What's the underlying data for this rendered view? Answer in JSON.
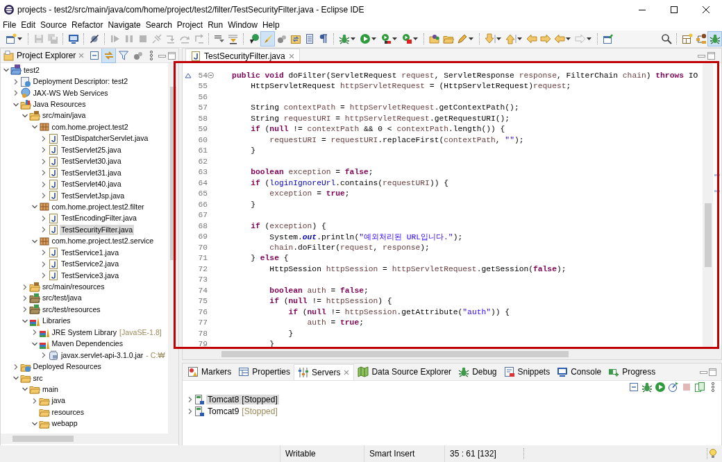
{
  "window": {
    "title": "projects - test2/src/main/java/com/home/project/test2/filter/TestSecurityFilter.java - Eclipse IDE"
  },
  "menu": [
    "File",
    "Edit",
    "Source",
    "Refactor",
    "Navigate",
    "Search",
    "Project",
    "Run",
    "Window",
    "Help"
  ],
  "project_explorer": {
    "title": "Project Explorer",
    "tree": [
      {
        "label": "test2",
        "kind": "project",
        "expanded": true,
        "selected": false,
        "children": [
          {
            "label": "Deployment Descriptor: test2",
            "kind": "descriptor",
            "expanded": false,
            "selected": false
          },
          {
            "label": "JAX-WS Web Services",
            "kind": "webservices",
            "expanded": false,
            "selected": false
          },
          {
            "label": "Java Resources",
            "kind": "javaresources",
            "expanded": true,
            "selected": false,
            "children": [
              {
                "label": "src/main/java",
                "kind": "sourcefolder",
                "expanded": true,
                "selected": false,
                "children": [
                  {
                    "label": "com.home.project.test2",
                    "kind": "package",
                    "expanded": true,
                    "selected": false,
                    "children": [
                      {
                        "label": "TestDispatcherServlet.java",
                        "kind": "javafile",
                        "expanded": false,
                        "selected": false
                      },
                      {
                        "label": "TestServlet25.java",
                        "kind": "javafile",
                        "expanded": false,
                        "selected": false
                      },
                      {
                        "label": "TestServlet30.java",
                        "kind": "javafile",
                        "expanded": false,
                        "selected": false
                      },
                      {
                        "label": "TestServlet31.java",
                        "kind": "javafile",
                        "expanded": false,
                        "selected": false
                      },
                      {
                        "label": "TestServlet40.java",
                        "kind": "javafile",
                        "expanded": false,
                        "selected": false
                      },
                      {
                        "label": "TestServletJsp.java",
                        "kind": "javafile",
                        "expanded": false,
                        "selected": false
                      }
                    ]
                  },
                  {
                    "label": "com.home.project.test2.filter",
                    "kind": "package",
                    "expanded": true,
                    "selected": false,
                    "children": [
                      {
                        "label": "TestEncodingFilter.java",
                        "kind": "javafile",
                        "expanded": false,
                        "selected": false
                      },
                      {
                        "label": "TestSecurityFilter.java",
                        "kind": "javafile",
                        "expanded": false,
                        "selected": true
                      }
                    ]
                  },
                  {
                    "label": "com.home.project.test2.service",
                    "kind": "package",
                    "expanded": true,
                    "selected": false,
                    "children": [
                      {
                        "label": "TestService1.java",
                        "kind": "javafile",
                        "expanded": false,
                        "selected": false
                      },
                      {
                        "label": "TestService2.java",
                        "kind": "javafile",
                        "expanded": false,
                        "selected": false
                      },
                      {
                        "label": "TestService3.java",
                        "kind": "javafile",
                        "expanded": false,
                        "selected": false
                      }
                    ]
                  }
                ]
              },
              {
                "label": "src/main/resources",
                "kind": "sourcefolder",
                "expanded": false,
                "selected": false
              },
              {
                "label": "src/test/java",
                "kind": "testfolder",
                "expanded": false,
                "selected": false
              },
              {
                "label": "src/test/resources",
                "kind": "testfolder",
                "expanded": false,
                "selected": false
              },
              {
                "label": "Libraries",
                "kind": "library",
                "expanded": true,
                "selected": false,
                "children": [
                  {
                    "label": "JRE System Library",
                    "decoration": "[JavaSE-1.8]",
                    "kind": "library",
                    "expanded": false,
                    "selected": false
                  },
                  {
                    "label": "Maven Dependencies",
                    "kind": "library",
                    "expanded": true,
                    "selected": false,
                    "children": [
                      {
                        "label": "javax.servlet-api-3.1.0.jar",
                        "decoration": "- C:₩",
                        "kind": "jar",
                        "expanded": false,
                        "selected": false
                      }
                    ]
                  }
                ]
              }
            ]
          },
          {
            "label": "Deployed Resources",
            "kind": "deployed",
            "expanded": false,
            "selected": false
          },
          {
            "label": "src",
            "kind": "folder",
            "expanded": true,
            "selected": false,
            "children": [
              {
                "label": "main",
                "kind": "folder",
                "expanded": true,
                "selected": false,
                "children": [
                  {
                    "label": "java",
                    "kind": "folder",
                    "expanded": false,
                    "selected": false
                  },
                  {
                    "label": "resources",
                    "kind": "folder",
                    "selected": false
                  },
                  {
                    "label": "webapp",
                    "kind": "folder",
                    "expanded": true,
                    "selected": false
                  }
                ]
              }
            ]
          }
        ]
      }
    ]
  },
  "editor": {
    "tab": {
      "label": "TestSecurityFilter.java",
      "selected": true
    },
    "highlighted": true,
    "lines": [
      {
        "number": "54",
        "override": true,
        "fold_expanded": true,
        "tokens": [
          {
            "kind": "keyword",
            "text": "    public void"
          },
          {
            "kind": "plain",
            "text": " doFilter(ServletRequest "
          },
          {
            "kind": "local",
            "text": "request"
          },
          {
            "kind": "plain",
            "text": ", ServletResponse "
          },
          {
            "kind": "local",
            "text": "response"
          },
          {
            "kind": "plain",
            "text": ", FilterChain "
          },
          {
            "kind": "local",
            "text": "chain"
          },
          {
            "kind": "plain",
            "text": ") "
          },
          {
            "kind": "keyword",
            "text": "throws"
          },
          {
            "kind": "plain",
            "text": " IO"
          }
        ]
      },
      {
        "number": "55",
        "tokens": [
          {
            "kind": "plain",
            "text": "        HttpServletRequest "
          },
          {
            "kind": "local",
            "text": "httpServletRequest"
          },
          {
            "kind": "plain",
            "text": " = (HttpServletRequest)"
          },
          {
            "kind": "local",
            "text": "request"
          },
          {
            "kind": "plain",
            "text": ";"
          }
        ]
      },
      {
        "number": "56"
      },
      {
        "number": "57",
        "tokens": [
          {
            "kind": "plain",
            "text": "        String "
          },
          {
            "kind": "local",
            "text": "contextPath"
          },
          {
            "kind": "plain",
            "text": " = "
          },
          {
            "kind": "local",
            "text": "httpServletRequest"
          },
          {
            "kind": "plain",
            "text": ".getContextPath();"
          }
        ]
      },
      {
        "number": "58",
        "tokens": [
          {
            "kind": "plain",
            "text": "        String "
          },
          {
            "kind": "local",
            "text": "requestURI"
          },
          {
            "kind": "plain",
            "text": " = "
          },
          {
            "kind": "local",
            "text": "httpServletRequest"
          },
          {
            "kind": "plain",
            "text": ".getRequestURI();"
          }
        ]
      },
      {
        "number": "59",
        "tokens": [
          {
            "kind": "keyword",
            "text": "        if"
          },
          {
            "kind": "plain",
            "text": " ("
          },
          {
            "kind": "keyword",
            "text": "null"
          },
          {
            "kind": "plain",
            "text": " != "
          },
          {
            "kind": "local",
            "text": "contextPath"
          },
          {
            "kind": "plain",
            "text": " && 0 < "
          },
          {
            "kind": "local",
            "text": "contextPath"
          },
          {
            "kind": "plain",
            "text": ".length()) {"
          }
        ]
      },
      {
        "number": "60",
        "tokens": [
          {
            "kind": "local",
            "text": "            requestURI"
          },
          {
            "kind": "plain",
            "text": " = "
          },
          {
            "kind": "local",
            "text": "requestURI"
          },
          {
            "kind": "plain",
            "text": ".replaceFirst("
          },
          {
            "kind": "local",
            "text": "contextPath"
          },
          {
            "kind": "plain",
            "text": ", "
          },
          {
            "kind": "string",
            "text": "\"\""
          },
          {
            "kind": "plain",
            "text": ");"
          }
        ]
      },
      {
        "number": "61",
        "tokens": [
          {
            "kind": "plain",
            "text": "        }"
          }
        ]
      },
      {
        "number": "62"
      },
      {
        "number": "63",
        "tokens": [
          {
            "kind": "keyword",
            "text": "        boolean "
          },
          {
            "kind": "local",
            "text": "exception"
          },
          {
            "kind": "plain",
            "text": " = "
          },
          {
            "kind": "keyword",
            "text": "false"
          },
          {
            "kind": "plain",
            "text": ";"
          }
        ]
      },
      {
        "number": "64",
        "tokens": [
          {
            "kind": "keyword",
            "text": "        if"
          },
          {
            "kind": "plain",
            "text": " ("
          },
          {
            "kind": "field",
            "text": "loginIgnoreUrl"
          },
          {
            "kind": "plain",
            "text": ".contains("
          },
          {
            "kind": "local",
            "text": "requestURI"
          },
          {
            "kind": "plain",
            "text": ")) {"
          }
        ]
      },
      {
        "number": "65",
        "tokens": [
          {
            "kind": "local",
            "text": "            exception"
          },
          {
            "kind": "plain",
            "text": " = "
          },
          {
            "kind": "keyword",
            "text": "true"
          },
          {
            "kind": "plain",
            "text": ";"
          }
        ]
      },
      {
        "number": "66",
        "tokens": [
          {
            "kind": "plain",
            "text": "        }"
          }
        ]
      },
      {
        "number": "67"
      },
      {
        "number": "68",
        "tokens": [
          {
            "kind": "keyword",
            "text": "        if"
          },
          {
            "kind": "plain",
            "text": " ("
          },
          {
            "kind": "local",
            "text": "exception"
          },
          {
            "kind": "plain",
            "text": ") {"
          }
        ]
      },
      {
        "number": "69",
        "tokens": [
          {
            "kind": "plain",
            "text": "            System."
          },
          {
            "kind": "static_field",
            "text": "out"
          },
          {
            "kind": "plain",
            "text": ".println("
          },
          {
            "kind": "string",
            "text": "\"예외처리된 URL입니다.\""
          },
          {
            "kind": "plain",
            "text": ");"
          }
        ]
      },
      {
        "number": "70",
        "tokens": [
          {
            "kind": "local",
            "text": "            chain"
          },
          {
            "kind": "plain",
            "text": ".doFilter("
          },
          {
            "kind": "local",
            "text": "request"
          },
          {
            "kind": "plain",
            "text": ", "
          },
          {
            "kind": "local",
            "text": "response"
          },
          {
            "kind": "plain",
            "text": ");"
          }
        ]
      },
      {
        "number": "71",
        "tokens": [
          {
            "kind": "plain",
            "text": "        } "
          },
          {
            "kind": "keyword",
            "text": "else"
          },
          {
            "kind": "plain",
            "text": " {"
          }
        ]
      },
      {
        "number": "72",
        "tokens": [
          {
            "kind": "plain",
            "text": "            HttpSession "
          },
          {
            "kind": "local",
            "text": "httpSession"
          },
          {
            "kind": "plain",
            "text": " = "
          },
          {
            "kind": "local",
            "text": "httpServletRequest"
          },
          {
            "kind": "plain",
            "text": ".getSession("
          },
          {
            "kind": "keyword",
            "text": "false"
          },
          {
            "kind": "plain",
            "text": ");"
          }
        ]
      },
      {
        "number": "73"
      },
      {
        "number": "74",
        "tokens": [
          {
            "kind": "keyword",
            "text": "            boolean "
          },
          {
            "kind": "local",
            "text": "auth"
          },
          {
            "kind": "plain",
            "text": " = "
          },
          {
            "kind": "keyword",
            "text": "false"
          },
          {
            "kind": "plain",
            "text": ";"
          }
        ]
      },
      {
        "number": "75",
        "tokens": [
          {
            "kind": "keyword",
            "text": "            if"
          },
          {
            "kind": "plain",
            "text": " ("
          },
          {
            "kind": "keyword",
            "text": "null"
          },
          {
            "kind": "plain",
            "text": " != "
          },
          {
            "kind": "local",
            "text": "httpSession"
          },
          {
            "kind": "plain",
            "text": ") {"
          }
        ]
      },
      {
        "number": "76",
        "tokens": [
          {
            "kind": "keyword",
            "text": "                if"
          },
          {
            "kind": "plain",
            "text": " ("
          },
          {
            "kind": "keyword",
            "text": "null"
          },
          {
            "kind": "plain",
            "text": " != "
          },
          {
            "kind": "local",
            "text": "httpSession"
          },
          {
            "kind": "plain",
            "text": ".getAttribute("
          },
          {
            "kind": "string",
            "text": "\"auth\""
          },
          {
            "kind": "plain",
            "text": ")) {"
          }
        ]
      },
      {
        "number": "77",
        "tokens": [
          {
            "kind": "local",
            "text": "                    auth"
          },
          {
            "kind": "plain",
            "text": " = "
          },
          {
            "kind": "keyword",
            "text": "true"
          },
          {
            "kind": "plain",
            "text": ";"
          }
        ]
      },
      {
        "number": "78",
        "tokens": [
          {
            "kind": "plain",
            "text": "                }"
          }
        ]
      },
      {
        "number": "79",
        "tokens": [
          {
            "kind": "plain",
            "text": "            }"
          }
        ]
      }
    ]
  },
  "bottom_panel": {
    "tabs": [
      {
        "label": "Markers",
        "selected": false
      },
      {
        "label": "Properties",
        "selected": false
      },
      {
        "label": "Servers",
        "selected": true
      },
      {
        "label": "Data Source Explorer",
        "selected": false
      },
      {
        "label": "Debug",
        "selected": false
      },
      {
        "label": "Snippets",
        "selected": false
      },
      {
        "label": "Console",
        "selected": false
      },
      {
        "label": "Progress",
        "selected": false
      }
    ],
    "servers": [
      {
        "name": "Tomcat8",
        "status": "[Stopped]",
        "expanded": false,
        "selected": true
      },
      {
        "name": "Tomcat9",
        "status": "[Stopped]",
        "expanded": false,
        "selected": false
      }
    ]
  },
  "status_bar": [
    "Writable",
    "Smart Insert",
    "35 : 61 [132]"
  ]
}
